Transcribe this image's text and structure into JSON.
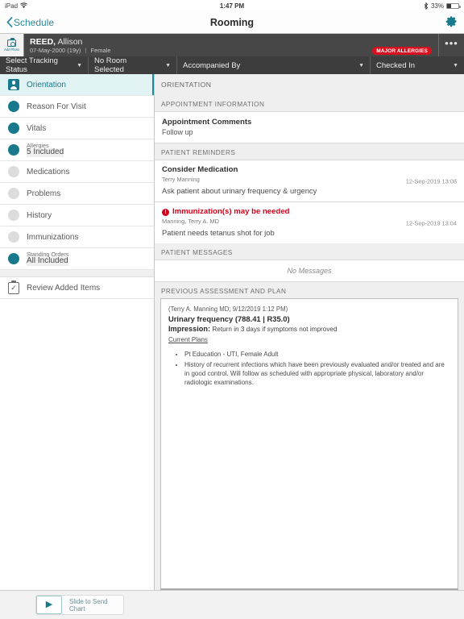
{
  "statusbar": {
    "device": "iPad",
    "wifi_icon": "wifi-icon",
    "time": "1:47 PM",
    "bluetooth_icon": "bluetooth-icon",
    "battery_percent": "33%",
    "battery_icon": "battery-icon"
  },
  "navbar": {
    "back_label": "Schedule",
    "back_icon": "chevron-left-icon",
    "title": "Rooming",
    "settings_icon": "gear-icon"
  },
  "patient": {
    "add_photo_label": "Add Photo",
    "camera_icon": "camera-icon",
    "last_name": "REED,",
    "first_name": "Allison",
    "dob": "07-May-2000 (19y)",
    "separator": "|",
    "sex": "Female",
    "allergy_badge": "MAJOR ALLERGIES",
    "more_icon": "•••"
  },
  "toolbar": {
    "tracking_status": "Select Tracking Status",
    "room": "No Room Selected",
    "accompanied_by": "Accompanied By",
    "checked_in": "Checked In",
    "caret": "▼"
  },
  "sidebar": {
    "items": [
      {
        "label": "Orientation",
        "icon": "person-badge-icon",
        "state": "selected"
      },
      {
        "label": "Reason For Visit",
        "icon": "status-dot-filled",
        "state": "filled"
      },
      {
        "label": "Vitals",
        "icon": "status-dot-filled",
        "state": "filled"
      },
      {
        "label": "Allergies",
        "sub": "5 Included",
        "icon": "status-dot-filled",
        "state": "filled"
      },
      {
        "label": "Medications",
        "icon": "status-dot-empty",
        "state": "empty"
      },
      {
        "label": "Problems",
        "icon": "status-dot-empty",
        "state": "empty"
      },
      {
        "label": "History",
        "icon": "status-dot-empty",
        "state": "empty"
      },
      {
        "label": "Immunizations",
        "icon": "status-dot-empty",
        "state": "empty"
      },
      {
        "label": "Standing Orders",
        "sub": "All Included",
        "icon": "status-dot-filled",
        "state": "filled"
      }
    ],
    "review": {
      "label": "Review Added Items",
      "icon": "clipboard-check-icon"
    }
  },
  "main": {
    "page_header": "ORIENTATION",
    "appointment": {
      "section_label": "APPOINTMENT INFORMATION",
      "comments_title": "Appointment Comments",
      "comments_body": "Follow up"
    },
    "reminders": {
      "section_label": "PATIENT REMINDERS",
      "items": [
        {
          "title": "Consider Medication",
          "alert": false,
          "author": "Terry Manning",
          "text": "Ask patient about urinary frequency & urgency",
          "timestamp": "12-Sep-2019 13:08"
        },
        {
          "title": "Immunization(s) may be needed",
          "alert": true,
          "alert_icon": "!",
          "author": "Manning, Terry A. MD",
          "text": "Patient needs tetanus shot for job",
          "timestamp": "12-Sep-2019 13:04"
        }
      ]
    },
    "messages": {
      "section_label": "PATIENT MESSAGES",
      "empty_text": "No Messages"
    },
    "assessment": {
      "section_label": "PREVIOUS ASSESSMENT AND PLAN",
      "meta": "(Terry A. Manning MD; 9/12/2019 1:12 PM)",
      "diagnosis": "Urinary frequency (788.41 | R35.0)",
      "impression_label": "Impression:",
      "impression_text": "Return in 3 days if symptoms not improved",
      "plans_link": "Current Plans",
      "bullets": [
        "Pt Education - UTI, Female Adult",
        "History of recurrent infections which have been previously evaluated and/or treated and are in good control. Will follow as scheduled with appropriate physical, laboratory and/or radiologic examinations."
      ]
    }
  },
  "footer": {
    "slide_label": "Slide to Send Chart",
    "slide_icon": "▶"
  },
  "colors": {
    "teal": "#17798b",
    "alert_red": "#d0021b",
    "header_gray": "#474747",
    "toolbar_gray": "#3d3d3d",
    "selected_row": "#e2f3f3"
  }
}
